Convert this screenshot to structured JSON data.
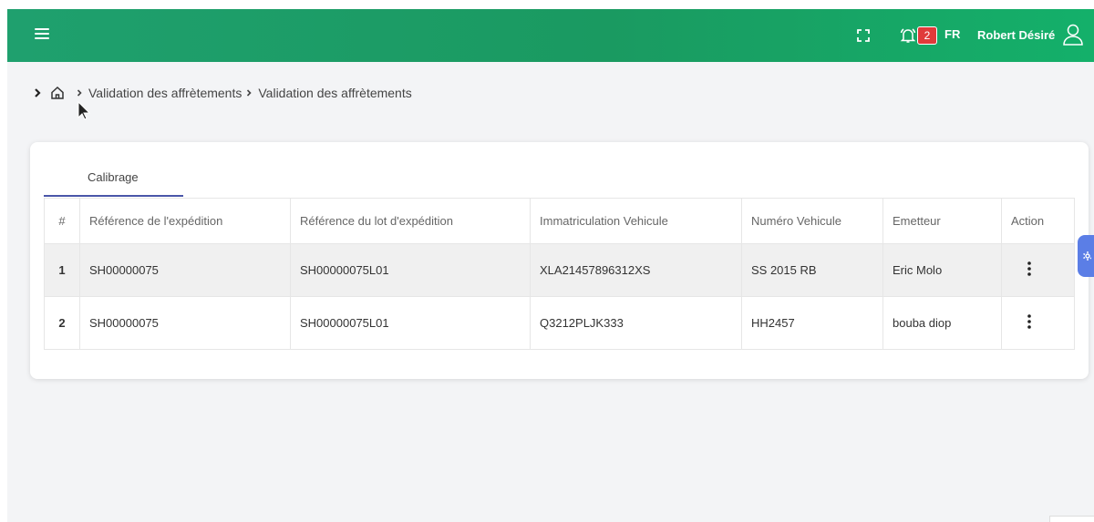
{
  "header": {
    "notification_count": "2",
    "language": "FR",
    "user_name": "Robert Désiré"
  },
  "breadcrumb": {
    "items": [
      "Validation des affrètements",
      "Validation des affrètements"
    ]
  },
  "tabs": [
    {
      "label": "Calibrage",
      "active": true
    }
  ],
  "table": {
    "columns": [
      "#",
      "Référence de l'expédition",
      "Référence du lot d'expédition",
      "Immatriculation Vehicule",
      "Numéro Vehicule",
      "Emetteur",
      "Action"
    ],
    "rows": [
      {
        "num": "1",
        "ref_expedition": "SH00000075",
        "ref_lot": "SH00000075L01",
        "immatriculation": "XLA21457896312XS",
        "numero": "SS 2015 RB",
        "emetteur": "Eric Molo"
      },
      {
        "num": "2",
        "ref_expedition": "SH00000075",
        "ref_lot": "SH00000075L01",
        "immatriculation": "Q3212PLJK333",
        "numero": "HH2457",
        "emetteur": "bouba diop"
      }
    ]
  },
  "colors": {
    "header_green": "#1a9a61",
    "tab_underline": "#4a56a8",
    "badge_red": "#e03a3a",
    "side_tab_blue": "#5b7ee6"
  },
  "icons": [
    "menu-icon",
    "fullscreen-icon",
    "bell-icon",
    "user-icon",
    "chevron-right-icon",
    "home-icon",
    "kebab-icon",
    "settings-icon"
  ]
}
